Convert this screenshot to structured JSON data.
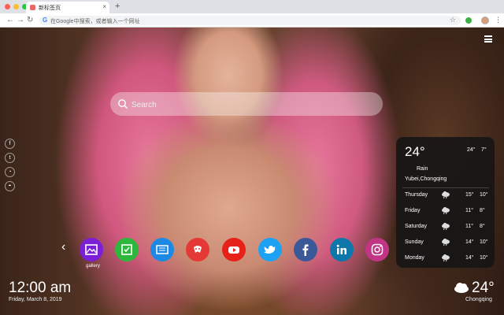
{
  "browser": {
    "tab_title": "新标签页",
    "tab_close": "×",
    "new_tab": "+",
    "omnibox_placeholder": "在Google中搜索，或者输入一个网址",
    "colors": {
      "close": "#ff5f57",
      "minimize": "#febc2e",
      "maximize": "#28c840"
    }
  },
  "search": {
    "placeholder": "Search"
  },
  "social_icons": [
    "facebook-icon",
    "twitter-icon",
    "snapchat-icon",
    "wechat-icon"
  ],
  "apps": [
    {
      "name": "gallery",
      "color": "#7b1fd6",
      "label": "gallery"
    },
    {
      "name": "tasks",
      "color": "#2db83d",
      "label": ""
    },
    {
      "name": "news",
      "color": "#1e88e5",
      "label": ""
    },
    {
      "name": "games",
      "color": "#e53935",
      "label": ""
    },
    {
      "name": "youtube",
      "color": "#e62117",
      "label": ""
    },
    {
      "name": "twitter",
      "color": "#1da1f2",
      "label": ""
    },
    {
      "name": "facebook",
      "color": "#3b5998",
      "label": ""
    },
    {
      "name": "linkedin",
      "color": "#0e76a8",
      "label": ""
    },
    {
      "name": "instagram",
      "color": "#c13584",
      "label": ""
    }
  ],
  "weather": {
    "temp": "24°",
    "high": "24°",
    "low": "7°",
    "condition": "Rain",
    "location": "Yubei,Chongqing",
    "forecast": [
      {
        "day": "Thursday",
        "high": "15°",
        "low": "10°"
      },
      {
        "day": "Friday",
        "high": "11°",
        "low": "8°"
      },
      {
        "day": "Saturday",
        "high": "11°",
        "low": "8°"
      },
      {
        "day": "Sunday",
        "high": "14°",
        "low": "10°"
      },
      {
        "day": "Monday",
        "high": "14°",
        "low": "10°"
      }
    ]
  },
  "clock": {
    "time": "12:00 am",
    "date": "Friday, March 8, 2019"
  },
  "bottom_weather": {
    "temp": "24°",
    "city": "Chongqing"
  }
}
